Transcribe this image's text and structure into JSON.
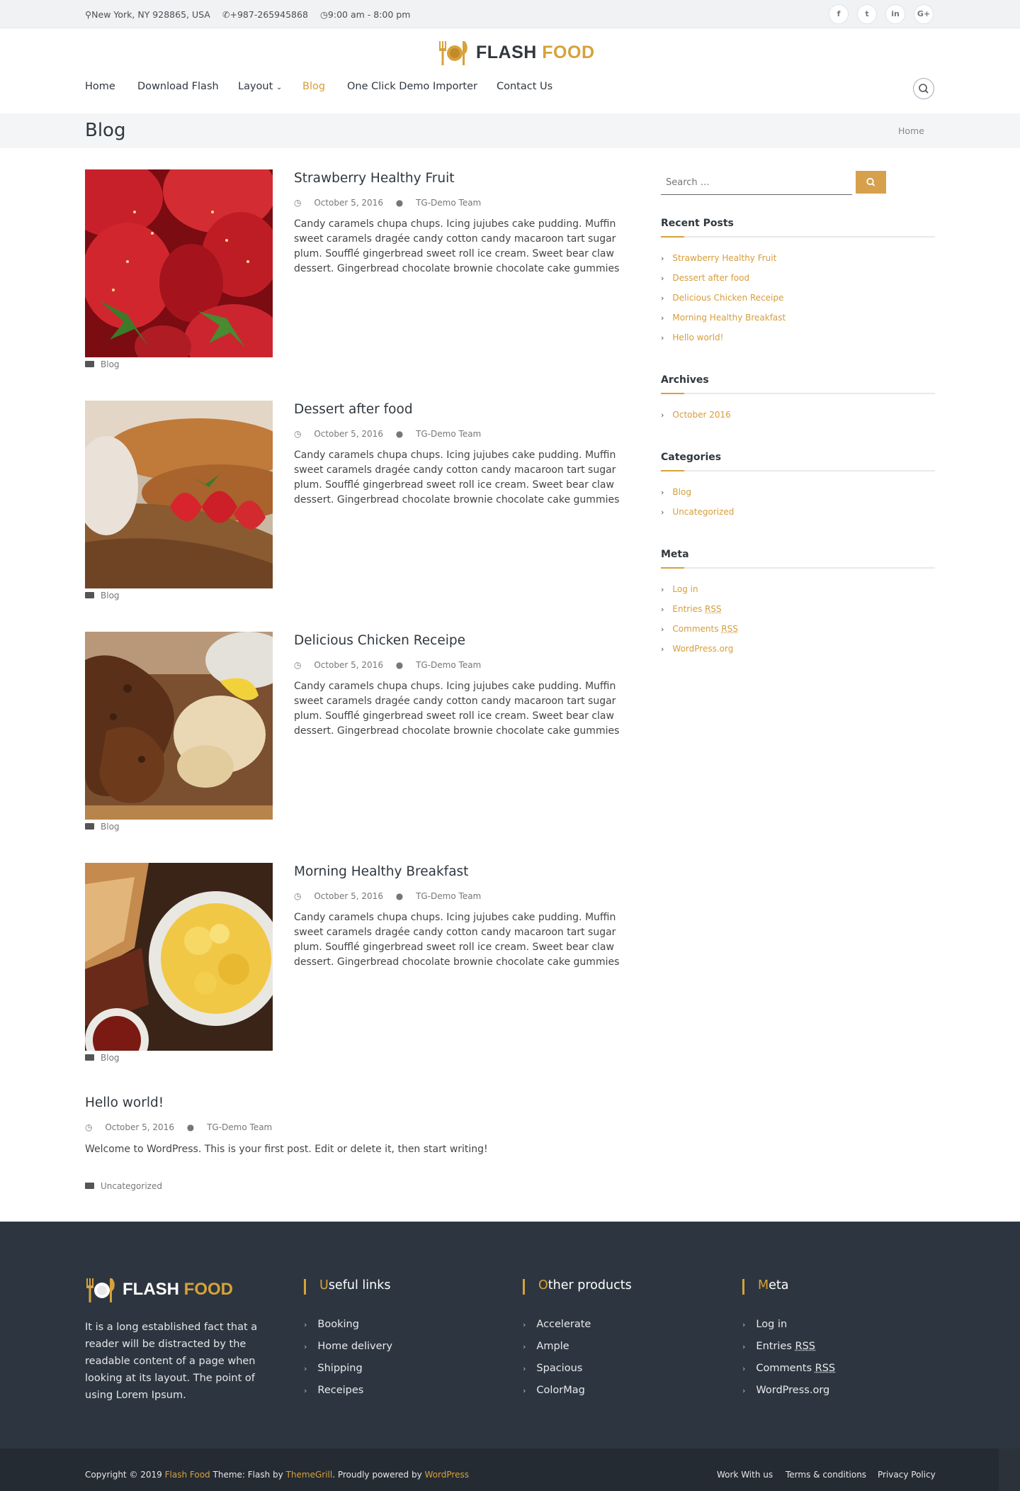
{
  "topbar": {
    "address": "New York, NY 928865, USA",
    "phone": "+987-265945868",
    "hours": "9:00 am - 8:00 pm",
    "social": [
      "f",
      "t",
      "in",
      "G+"
    ]
  },
  "brand": {
    "part1": "FLASH",
    "part2": "FOOD",
    "accent": "#d6a23a",
    "dark": "#30373e"
  },
  "nav": {
    "home": "Home",
    "download": "Download Flash",
    "layout": "Layout",
    "blog": "Blog",
    "importer": "One Click Demo Importer",
    "contact": "Contact Us"
  },
  "page": {
    "title": "Blog",
    "breadcrumb": "Home"
  },
  "posts": [
    {
      "title": "Strawberry Healthy Fruit",
      "date": "October 5, 2016",
      "author": "TG-Demo Team",
      "excerpt": "Candy caramels chupa chups. Icing jujubes cake pudding. Muffin sweet caramels dragée candy cotton candy macaroon tart sugar plum. Soufflé gingerbread sweet roll ice cream. Sweet bear claw dessert. Gingerbread chocolate brownie chocolate cake gummies",
      "category": "Blog"
    },
    {
      "title": "Dessert after food",
      "date": "October 5, 2016",
      "author": "TG-Demo Team",
      "excerpt": "Candy caramels chupa chups. Icing jujubes cake pudding. Muffin sweet caramels dragée candy cotton candy macaroon tart sugar plum. Soufflé gingerbread sweet roll ice cream. Sweet bear claw dessert. Gingerbread chocolate brownie chocolate cake gummies",
      "category": "Blog"
    },
    {
      "title": "Delicious Chicken Receipe",
      "date": "October 5, 2016",
      "author": "TG-Demo Team",
      "excerpt": "Candy caramels chupa chups. Icing jujubes cake pudding. Muffin sweet caramels dragée candy cotton candy macaroon tart sugar plum. Soufflé gingerbread sweet roll ice cream. Sweet bear claw dessert. Gingerbread chocolate brownie chocolate cake gummies",
      "category": "Blog"
    },
    {
      "title": "Morning Healthy Breakfast",
      "date": "October 5, 2016",
      "author": "TG-Demo Team",
      "excerpt": "Candy caramels chupa chups. Icing jujubes cake pudding. Muffin sweet caramels dragée candy cotton candy macaroon tart sugar plum. Soufflé gingerbread sweet roll ice cream. Sweet bear claw dessert. Gingerbread chocolate brownie chocolate cake gummies",
      "category": "Blog"
    },
    {
      "title": "Hello world!",
      "date": "October 5, 2016",
      "author": "TG-Demo Team",
      "excerpt": "Welcome to WordPress. This is your first post. Edit or delete it, then start writing!",
      "category": "Uncategorized"
    }
  ],
  "sidebar": {
    "search_placeholder": "Search …",
    "recent_title": "Recent Posts",
    "recent": [
      "Strawberry Healthy Fruit",
      "Dessert after food",
      "Delicious Chicken Receipe",
      "Morning Healthy Breakfast",
      "Hello world!"
    ],
    "archives_title": "Archives",
    "archives": [
      "October 2016"
    ],
    "categories_title": "Categories",
    "categories": [
      "Blog",
      "Uncategorized"
    ],
    "meta_title": "Meta",
    "meta": [
      "Log in",
      "Entries",
      "Comments",
      "WordPress.org"
    ],
    "rss": "RSS"
  },
  "footer": {
    "about": "It is a long established fact that a reader will be distracted by the readable content of a page when looking at its layout. The point of using Lorem Ipsum.",
    "col1": {
      "first": "U",
      "rest": "seful links",
      "items": [
        "Booking",
        "Home delivery",
        "Shipping",
        "Receipes"
      ]
    },
    "col2": {
      "first": "O",
      "rest": "ther products",
      "items": [
        "Accelerate",
        "Ample",
        "Spacious",
        "ColorMag"
      ]
    },
    "col3": {
      "first": "M",
      "rest": "eta",
      "items": [
        "Log in",
        "Entries",
        "Comments",
        "WordPress.org"
      ]
    },
    "rss": "RSS"
  },
  "bottom": {
    "copyright": "Copyright © 2019",
    "site": "Flash Food",
    "theme": "Theme: Flash by",
    "author": "ThemeGrill",
    "powered": ". Proudly powered by",
    "wp": "WordPress",
    "links": [
      "Work With us",
      "Terms & conditions",
      "Privacy Policy"
    ]
  }
}
